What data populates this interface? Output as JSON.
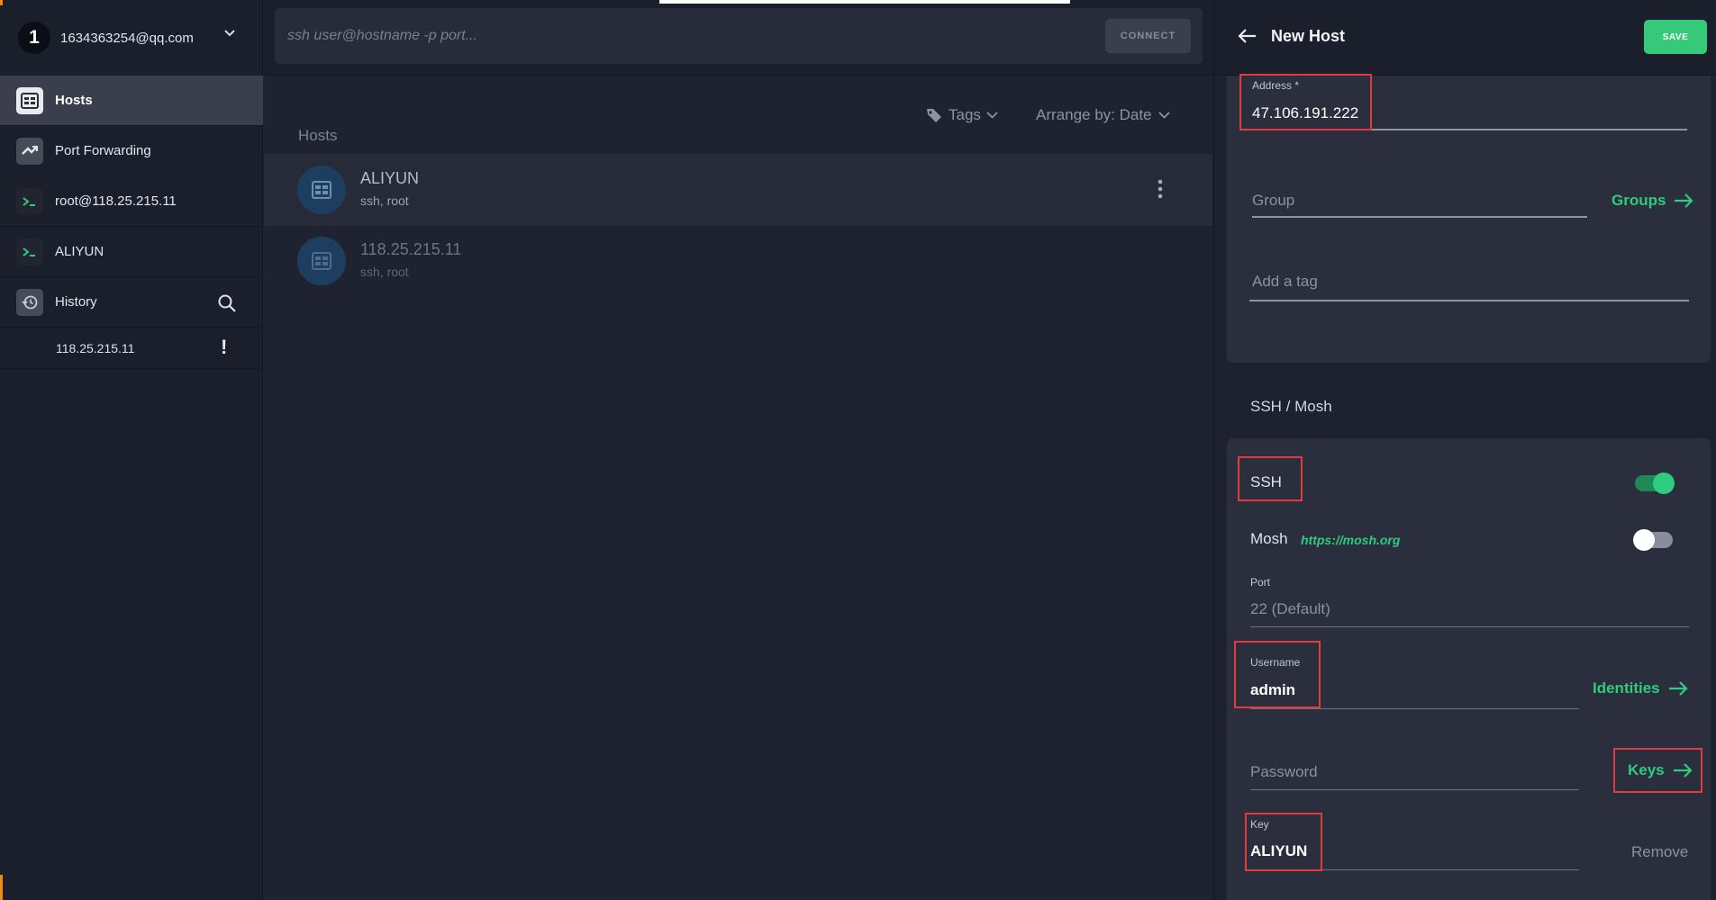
{
  "sidebar": {
    "account": {
      "number": "1",
      "email": "1634363254@qq.com"
    },
    "items": [
      {
        "label": "Hosts",
        "icon": "hosts-grid-icon",
        "active": true
      },
      {
        "label": "Port Forwarding",
        "icon": "port-forwarding-icon"
      },
      {
        "label": "root@118.25.215.11",
        "icon": "terminal-icon"
      },
      {
        "label": "ALIYUN",
        "icon": "terminal-icon"
      },
      {
        "label": "History",
        "icon": "history-icon"
      }
    ],
    "history_items": [
      {
        "label": "118.25.215.11",
        "status": "!"
      }
    ]
  },
  "main": {
    "command_placeholder": "ssh user@hostname -p port...",
    "connect_label": "CONNECT",
    "tags_label": "Tags",
    "arrange_label": "Arrange by: Date",
    "hosts_heading": "Hosts",
    "hosts": [
      {
        "name": "ALIYUN",
        "detail": "ssh, root",
        "selected": true
      },
      {
        "name": "118.25.215.11",
        "detail": "ssh, root",
        "selected": false
      }
    ]
  },
  "panel": {
    "title": "New Host",
    "save_label": "SAVE",
    "address_label": "Address *",
    "address_value": "47.106.191.222",
    "group_placeholder": "Group",
    "groups_link": "Groups",
    "tag_placeholder": "Add a tag",
    "section_title": "SSH / Mosh",
    "ssh_label": "SSH",
    "ssh_enabled": true,
    "mosh_label": "Mosh",
    "mosh_link": "https://mosh.org",
    "mosh_enabled": false,
    "port_label": "Port",
    "port_placeholder": "22 (Default)",
    "username_label": "Username",
    "username_value": "admin",
    "identities_link": "Identities",
    "password_placeholder": "Password",
    "keys_link": "Keys",
    "key_label": "Key",
    "key_value": "ALIYUN",
    "remove_label": "Remove"
  },
  "colors": {
    "accent_green": "#2fcb7e",
    "highlight_red": "#e23b3b",
    "orange_edge": "#f08a17"
  }
}
